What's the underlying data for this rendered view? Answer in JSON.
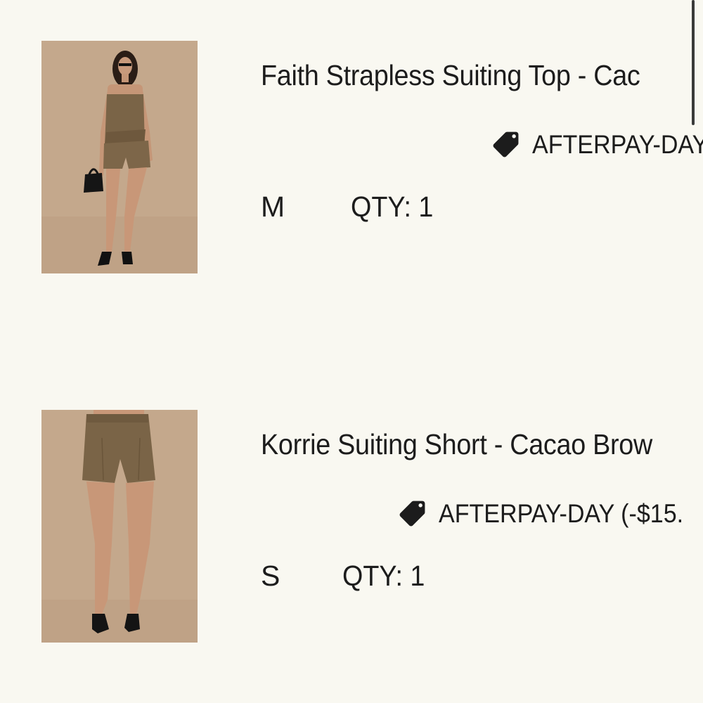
{
  "cart": {
    "items": [
      {
        "title": "Faith Strapless Suiting Top - Cac",
        "promo": "AFTERPAY-DAY",
        "size": "M",
        "qty": "QTY: 1",
        "image_alt": "Model wearing strapless suiting top and matching shorts",
        "tag_icon": "tag-icon"
      },
      {
        "title": "Korrie Suiting Short - Cacao Brow",
        "promo": "AFTERPAY-DAY (-$15.",
        "size": "S",
        "qty": "QTY: 1",
        "image_alt": "Model wearing cacao brown suiting shorts",
        "tag_icon": "tag-icon"
      }
    ]
  },
  "colors": {
    "background": "#f9f8f1",
    "text": "#1c1c1c",
    "product_brown": "#7a6447",
    "photo_backdrop": "#c7ab90"
  }
}
